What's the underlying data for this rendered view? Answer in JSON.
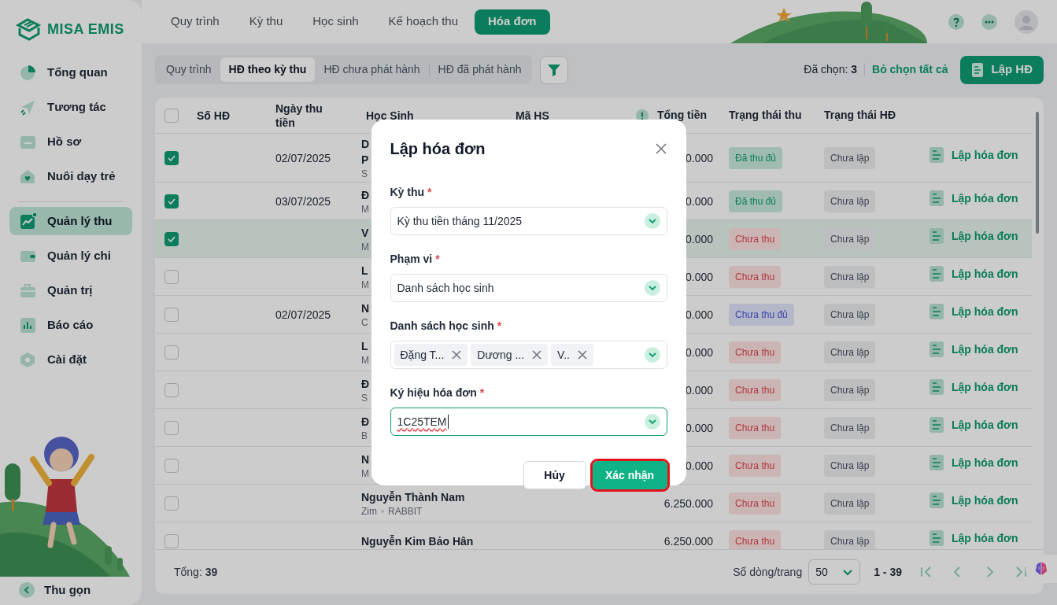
{
  "logo": {
    "text": "MISA EMIS"
  },
  "sidebar": {
    "groups": [
      [
        {
          "label": "Tổng quan",
          "selected": false
        },
        {
          "label": "Tương tác",
          "selected": false
        },
        {
          "label": "Hồ sơ",
          "selected": false
        },
        {
          "label": "Nuôi dạy trẻ",
          "selected": false
        }
      ],
      [
        {
          "label": "Quản lý thu",
          "selected": true
        },
        {
          "label": "Quản lý chi",
          "selected": false
        },
        {
          "label": "Quản trị",
          "selected": false
        },
        {
          "label": "Báo cáo",
          "selected": false
        },
        {
          "label": "Cài đặt",
          "selected": false
        }
      ]
    ],
    "collapse": "Thu gọn"
  },
  "top_tabs": [
    {
      "label": "Quy trình",
      "selected": false
    },
    {
      "label": "Kỳ thu",
      "selected": false
    },
    {
      "label": "Học sinh",
      "selected": false
    },
    {
      "label": "Kế hoạch thu",
      "selected": false
    },
    {
      "label": "Hóa đơn",
      "selected": true
    }
  ],
  "sub_tabs": [
    {
      "label": "Quy trình",
      "selected": false
    },
    {
      "label": "HĐ theo kỳ thu",
      "selected": true
    },
    {
      "label": "HĐ chưa phát hành",
      "selected": false
    },
    {
      "label": "HĐ đã phát hành",
      "selected": false
    }
  ],
  "selection": {
    "text": "Đã chọn: **3**",
    "clear": "Bỏ chọn tất cả"
  },
  "create_button": "Lập HĐ",
  "table": {
    "select_all_checked": false,
    "columns": [
      "Số HĐ",
      "Ngày thu tiền",
      "Học Sinh",
      "Mã HS",
      "Tổng tiền",
      "Trạng thái thu",
      "Trạng thái HĐ"
    ],
    "rows": [
      {
        "checked": true,
        "highlighted": false,
        "date": "02/07/2025",
        "name": "D\nP",
        "sub": [
          "S"
        ],
        "total": "0.000",
        "pay": {
          "label": "Đã thu đủ",
          "kind": "paid"
        },
        "invoice": {
          "label": "Chưa lập",
          "kind": "none"
        },
        "action": "Lập hóa đơn"
      },
      {
        "checked": true,
        "highlighted": false,
        "date": "03/07/2025",
        "name": "Đ",
        "sub": [
          "M"
        ],
        "total": "0.000",
        "pay": {
          "label": "Đã thu đủ",
          "kind": "paid"
        },
        "invoice": {
          "label": "Chưa lập",
          "kind": "none"
        },
        "action": "Lập hóa đơn"
      },
      {
        "checked": true,
        "highlighted": true,
        "date": "",
        "name": "V",
        "sub": [
          "M"
        ],
        "total": "0.000",
        "pay": {
          "label": "Chưa thu",
          "kind": "unpaid"
        },
        "invoice": {
          "label": "Chưa lập",
          "kind": "none"
        },
        "action": "Lập hóa đơn"
      },
      {
        "checked": false,
        "highlighted": false,
        "date": "",
        "name": "L",
        "sub": [
          "M"
        ],
        "total": "0.000",
        "pay": {
          "label": "Chưa thu",
          "kind": "unpaid"
        },
        "invoice": {
          "label": "Chưa lập",
          "kind": "none"
        },
        "action": "Lập hóa đơn"
      },
      {
        "checked": false,
        "highlighted": false,
        "date": "02/07/2025",
        "name": "N",
        "sub": [
          "C"
        ],
        "total": "0.000",
        "pay": {
          "label": "Chưa thu đủ",
          "kind": "partial"
        },
        "invoice": {
          "label": "Chưa lập",
          "kind": "none"
        },
        "action": "Lập hóa đơn"
      },
      {
        "checked": false,
        "highlighted": false,
        "date": "",
        "name": "L",
        "sub": [
          "M"
        ],
        "total": "0.000",
        "pay": {
          "label": "Chưa thu",
          "kind": "unpaid"
        },
        "invoice": {
          "label": "Chưa lập",
          "kind": "none"
        },
        "action": "Lập hóa đơn"
      },
      {
        "checked": false,
        "highlighted": false,
        "date": "",
        "name": "Đ",
        "sub": [
          "S"
        ],
        "total": "0.000",
        "pay": {
          "label": "Chưa thu",
          "kind": "unpaid"
        },
        "invoice": {
          "label": "Chưa lập",
          "kind": "none"
        },
        "action": "Lập hóa đơn"
      },
      {
        "checked": false,
        "highlighted": false,
        "date": "",
        "name": "Đ",
        "sub": [
          "B"
        ],
        "total": "0.000",
        "pay": {
          "label": "Chưa thu",
          "kind": "unpaid"
        },
        "invoice": {
          "label": "Chưa lập",
          "kind": "none"
        },
        "action": "Lập hóa đơn"
      },
      {
        "checked": false,
        "highlighted": false,
        "date": "",
        "name": "N",
        "sub": [
          "M"
        ],
        "total": "0.000",
        "pay": {
          "label": "Chưa thu",
          "kind": "unpaid"
        },
        "invoice": {
          "label": "Chưa lập",
          "kind": "none"
        },
        "action": "Lập hóa đơn"
      },
      {
        "checked": false,
        "highlighted": false,
        "date": "",
        "name": "Nguyễn Thành Nam",
        "sub": [
          "Zim",
          "RABBIT"
        ],
        "total": "6.250.000",
        "pay": {
          "label": "Chưa thu",
          "kind": "unpaid"
        },
        "invoice": {
          "label": "Chưa lập",
          "kind": "none"
        },
        "action": "Lập hóa đơn"
      },
      {
        "checked": false,
        "highlighted": false,
        "date": "",
        "name": "Nguyễn Kim Bảo Hân",
        "total": "6.250.000",
        "pay": {
          "label": "Chưa thu",
          "kind": "unpaid"
        },
        "invoice": {
          "label": "Chưa lập",
          "kind": "none"
        },
        "action": "Lập hóa đơn"
      }
    ]
  },
  "footer": {
    "total": "Tổng: **39**",
    "per_page_label": "Số dòng/trang",
    "per_page": "50",
    "range": "1 - 39"
  },
  "modal": {
    "title": "Lập hóa đơn",
    "fields": [
      {
        "label": "Kỳ thu",
        "required_mark": "*",
        "kind": "select",
        "value": "Kỳ thu tiền tháng 11/2025",
        "focused": false
      },
      {
        "label": "Phạm vi",
        "required_mark": "*",
        "kind": "select",
        "value": "Danh sách học sinh",
        "focused": false
      },
      {
        "label": "Danh sách học sinh",
        "required_mark": "*",
        "kind": "tags",
        "tags": [
          "Đặng T...",
          "Dương ...",
          "V.."
        ],
        "focused": false
      },
      {
        "label": "Ký hiệu hóa đơn",
        "required_mark": "*",
        "kind": "select",
        "value": "1C25TEM",
        "focused": true
      }
    ],
    "buttons": [
      {
        "label": "Hủy",
        "kind": "secondary",
        "highlighted": false
      },
      {
        "label": "Xác nhận",
        "kind": "primary",
        "highlighted": true
      }
    ]
  }
}
